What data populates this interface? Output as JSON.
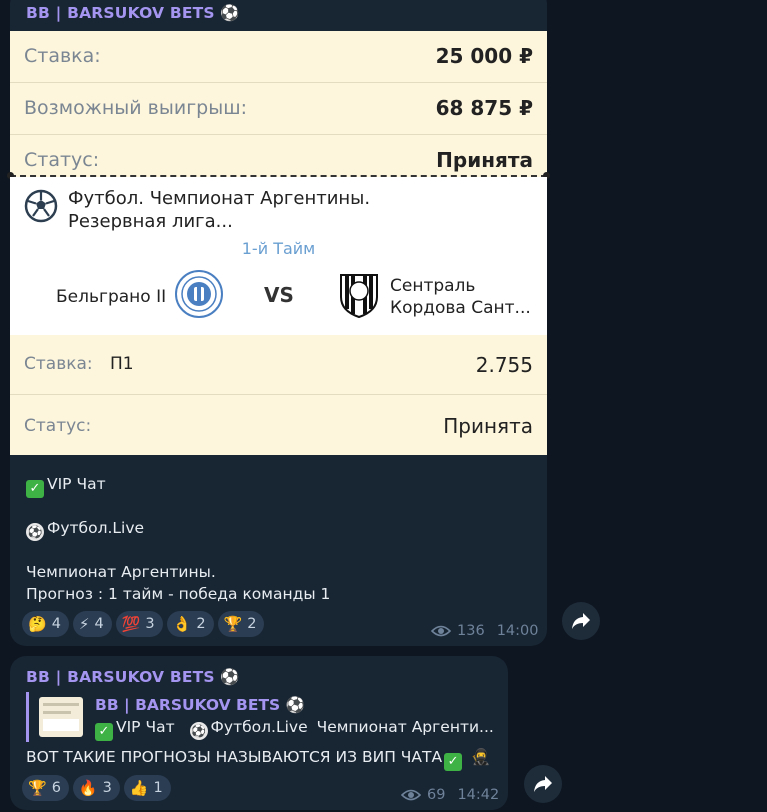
{
  "channel_name": "BB | BARSUKOV BETS",
  "message1": {
    "bet_card": {
      "stake_label": "Ставка:",
      "stake_value": "25 000 ₽",
      "win_label": "Возможный выигрыш:",
      "win_value": "68 875 ₽",
      "status_label": "Статус:",
      "status_value": "Принята",
      "league_line1": "Футбол. Чемпионат Аргентины.",
      "league_line2": "Резервная лига...",
      "period": "1-й Тайм",
      "team1": "Бельграно II",
      "vs": "VS",
      "team2_line1": "Сентраль",
      "team2_line2": "Кордова Сант...",
      "bet_label": "Ставка:",
      "bet_pick": "П1",
      "bet_odds": "2.755",
      "status2_label": "Статус:",
      "status2_value": "Принята"
    },
    "lines": {
      "vip": "VIP Чат",
      "football": "Футбол.Live",
      "champ": "Чемпионат Аргентины.",
      "forecast": "Прогноз : 1 тайм - победа команды 1"
    },
    "reactions": [
      {
        "emoji": "🤔",
        "count": "4"
      },
      {
        "emoji": "⚡",
        "count": "4"
      },
      {
        "emoji": "💯",
        "count": "3"
      },
      {
        "emoji": "👌",
        "count": "2"
      },
      {
        "emoji": "🏆",
        "count": "2"
      }
    ],
    "views": "136",
    "time": "14:00"
  },
  "message2": {
    "reply_name": "BB | BARSUKOV BETS",
    "reply_vip": "VIP Чат",
    "reply_football": "Футбол.Live",
    "reply_rest": "Чемпионат Аргенти...",
    "text": "ВОТ ТАКИЕ ПРОГНОЗЫ НАЗЫВАЮТСЯ ИЗ ВИП ЧАТА",
    "reactions": [
      {
        "emoji": "🏆",
        "count": "6"
      },
      {
        "emoji": "🔥",
        "count": "3"
      },
      {
        "emoji": "👍",
        "count": "1"
      }
    ],
    "views": "69",
    "time": "14:42"
  },
  "icons": [
    "soccer-ball-icon",
    "checkmark-icon",
    "eye-icon",
    "share-arrow-icon",
    "ninja-icon"
  ],
  "colors": {
    "background": "#0e1621",
    "bubble": "#182533",
    "sender": "#a495f0",
    "card": "#fdf6dc"
  }
}
